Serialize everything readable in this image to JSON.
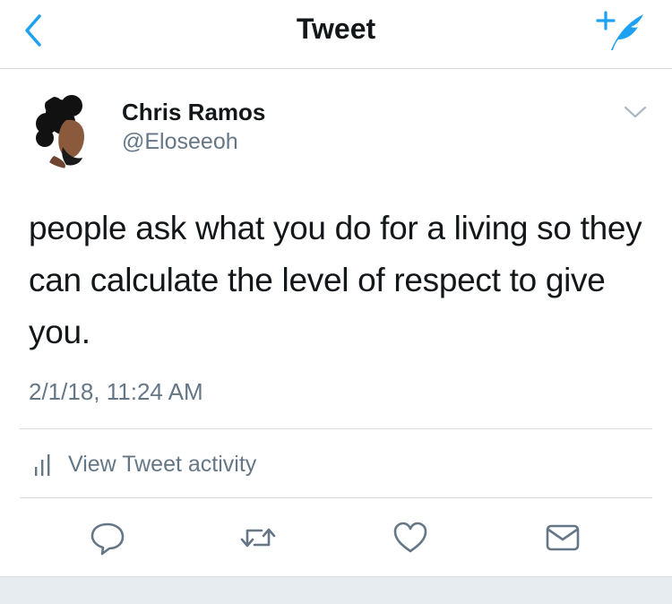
{
  "nav": {
    "title": "Tweet",
    "back_icon": "chevron-left-icon",
    "compose_icon": "compose-tweet-icon"
  },
  "tweet": {
    "author_name": "Chris Ramos",
    "author_handle": "@Eloseeoh",
    "text_lines": [
      "people ask what you do for a living so they",
      "can calculate the level of respect to give",
      "you."
    ],
    "timestamp": "2/1/18, 11:24 AM"
  },
  "activity": {
    "label": "View Tweet activity",
    "icon": "bar-chart-icon"
  },
  "actions": [
    {
      "name": "reply",
      "icon": "reply-icon"
    },
    {
      "name": "retweet",
      "icon": "retweet-icon"
    },
    {
      "name": "like",
      "icon": "heart-icon"
    },
    {
      "name": "direct-message",
      "icon": "envelope-icon"
    }
  ],
  "colors": {
    "accent": "#1da1f2",
    "text": "#14171a",
    "secondary_text": "#657786",
    "divider": "#d8dde1"
  }
}
